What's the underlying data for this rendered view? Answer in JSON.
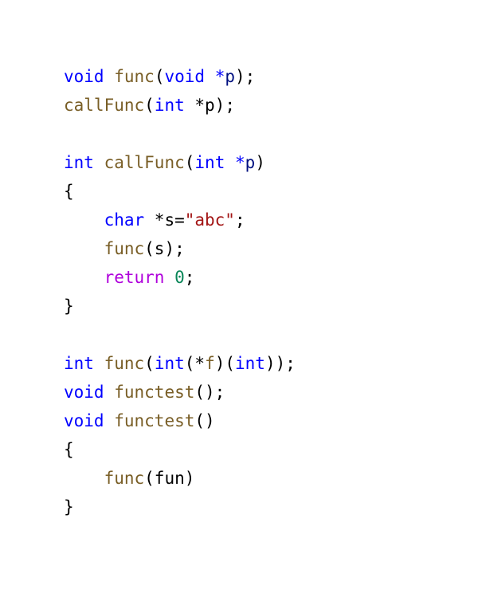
{
  "colors": {
    "keyword": "#0000ff",
    "control": "#af00db",
    "function": "#795e26",
    "parameter": "#001080",
    "string": "#a31515",
    "number": "#098658",
    "plain": "#000000",
    "background": "#ffffff"
  },
  "code": {
    "lines": [
      [
        {
          "t": "void",
          "c": "keyword"
        },
        {
          "t": " ",
          "c": "plain"
        },
        {
          "t": "func",
          "c": "function"
        },
        {
          "t": "(",
          "c": "plain"
        },
        {
          "t": "void",
          "c": "keyword"
        },
        {
          "t": " ",
          "c": "plain"
        },
        {
          "t": "*",
          "c": "keyword"
        },
        {
          "t": "p",
          "c": "parameter"
        },
        {
          "t": ");",
          "c": "plain"
        }
      ],
      [
        {
          "t": "callFunc",
          "c": "function"
        },
        {
          "t": "(",
          "c": "plain"
        },
        {
          "t": "int",
          "c": "keyword"
        },
        {
          "t": " *p);",
          "c": "plain"
        }
      ],
      [],
      [
        {
          "t": "int",
          "c": "keyword"
        },
        {
          "t": " ",
          "c": "plain"
        },
        {
          "t": "callFunc",
          "c": "function"
        },
        {
          "t": "(",
          "c": "plain"
        },
        {
          "t": "int",
          "c": "keyword"
        },
        {
          "t": " ",
          "c": "plain"
        },
        {
          "t": "*",
          "c": "keyword"
        },
        {
          "t": "p",
          "c": "parameter"
        },
        {
          "t": ")",
          "c": "plain"
        }
      ],
      [
        {
          "t": "{",
          "c": "plain"
        }
      ],
      [
        {
          "t": "    ",
          "c": "plain"
        },
        {
          "t": "char",
          "c": "keyword"
        },
        {
          "t": " *s=",
          "c": "plain"
        },
        {
          "t": "\"abc\"",
          "c": "string"
        },
        {
          "t": ";",
          "c": "plain"
        }
      ],
      [
        {
          "t": "    ",
          "c": "plain"
        },
        {
          "t": "func",
          "c": "function"
        },
        {
          "t": "(s);",
          "c": "plain"
        }
      ],
      [
        {
          "t": "    ",
          "c": "plain"
        },
        {
          "t": "return",
          "c": "control"
        },
        {
          "t": " ",
          "c": "plain"
        },
        {
          "t": "0",
          "c": "number"
        },
        {
          "t": ";",
          "c": "plain"
        }
      ],
      [
        {
          "t": "}",
          "c": "plain"
        }
      ],
      [],
      [
        {
          "t": "int",
          "c": "keyword"
        },
        {
          "t": " ",
          "c": "plain"
        },
        {
          "t": "func",
          "c": "function"
        },
        {
          "t": "(",
          "c": "plain"
        },
        {
          "t": "int",
          "c": "keyword"
        },
        {
          "t": "(*",
          "c": "plain"
        },
        {
          "t": "f",
          "c": "function"
        },
        {
          "t": ")(",
          "c": "plain"
        },
        {
          "t": "int",
          "c": "keyword"
        },
        {
          "t": "));",
          "c": "plain"
        }
      ],
      [
        {
          "t": "void",
          "c": "keyword"
        },
        {
          "t": " ",
          "c": "plain"
        },
        {
          "t": "functest",
          "c": "function"
        },
        {
          "t": "();",
          "c": "plain"
        }
      ],
      [
        {
          "t": "void",
          "c": "keyword"
        },
        {
          "t": " ",
          "c": "plain"
        },
        {
          "t": "functest",
          "c": "function"
        },
        {
          "t": "()",
          "c": "plain"
        }
      ],
      [
        {
          "t": "{",
          "c": "plain"
        }
      ],
      [
        {
          "t": "    ",
          "c": "plain"
        },
        {
          "t": "func",
          "c": "function"
        },
        {
          "t": "(fun)",
          "c": "plain"
        }
      ],
      [
        {
          "t": "}",
          "c": "plain"
        }
      ]
    ]
  }
}
